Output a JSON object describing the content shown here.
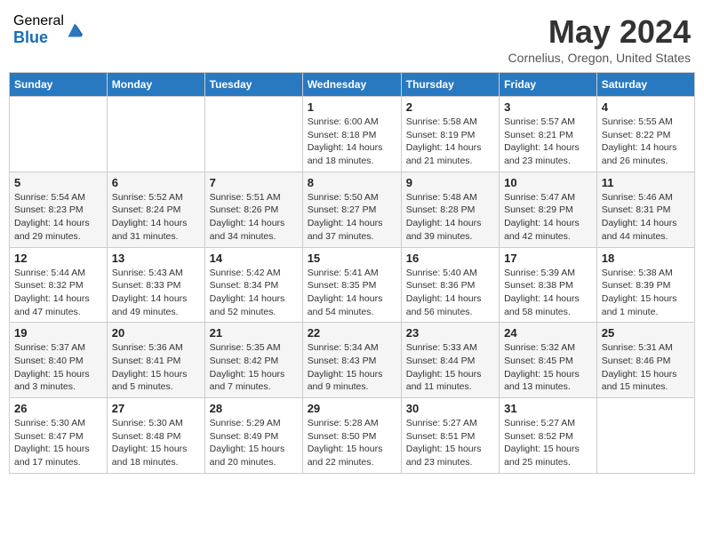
{
  "header": {
    "logo_general": "General",
    "logo_blue": "Blue",
    "month_title": "May 2024",
    "location": "Cornelius, Oregon, United States"
  },
  "days_of_week": [
    "Sunday",
    "Monday",
    "Tuesday",
    "Wednesday",
    "Thursday",
    "Friday",
    "Saturday"
  ],
  "weeks": [
    [
      {
        "day": "",
        "info": ""
      },
      {
        "day": "",
        "info": ""
      },
      {
        "day": "",
        "info": ""
      },
      {
        "day": "1",
        "info": "Sunrise: 6:00 AM\nSunset: 8:18 PM\nDaylight: 14 hours\nand 18 minutes."
      },
      {
        "day": "2",
        "info": "Sunrise: 5:58 AM\nSunset: 8:19 PM\nDaylight: 14 hours\nand 21 minutes."
      },
      {
        "day": "3",
        "info": "Sunrise: 5:57 AM\nSunset: 8:21 PM\nDaylight: 14 hours\nand 23 minutes."
      },
      {
        "day": "4",
        "info": "Sunrise: 5:55 AM\nSunset: 8:22 PM\nDaylight: 14 hours\nand 26 minutes."
      }
    ],
    [
      {
        "day": "5",
        "info": "Sunrise: 5:54 AM\nSunset: 8:23 PM\nDaylight: 14 hours\nand 29 minutes."
      },
      {
        "day": "6",
        "info": "Sunrise: 5:52 AM\nSunset: 8:24 PM\nDaylight: 14 hours\nand 31 minutes."
      },
      {
        "day": "7",
        "info": "Sunrise: 5:51 AM\nSunset: 8:26 PM\nDaylight: 14 hours\nand 34 minutes."
      },
      {
        "day": "8",
        "info": "Sunrise: 5:50 AM\nSunset: 8:27 PM\nDaylight: 14 hours\nand 37 minutes."
      },
      {
        "day": "9",
        "info": "Sunrise: 5:48 AM\nSunset: 8:28 PM\nDaylight: 14 hours\nand 39 minutes."
      },
      {
        "day": "10",
        "info": "Sunrise: 5:47 AM\nSunset: 8:29 PM\nDaylight: 14 hours\nand 42 minutes."
      },
      {
        "day": "11",
        "info": "Sunrise: 5:46 AM\nSunset: 8:31 PM\nDaylight: 14 hours\nand 44 minutes."
      }
    ],
    [
      {
        "day": "12",
        "info": "Sunrise: 5:44 AM\nSunset: 8:32 PM\nDaylight: 14 hours\nand 47 minutes."
      },
      {
        "day": "13",
        "info": "Sunrise: 5:43 AM\nSunset: 8:33 PM\nDaylight: 14 hours\nand 49 minutes."
      },
      {
        "day": "14",
        "info": "Sunrise: 5:42 AM\nSunset: 8:34 PM\nDaylight: 14 hours\nand 52 minutes."
      },
      {
        "day": "15",
        "info": "Sunrise: 5:41 AM\nSunset: 8:35 PM\nDaylight: 14 hours\nand 54 minutes."
      },
      {
        "day": "16",
        "info": "Sunrise: 5:40 AM\nSunset: 8:36 PM\nDaylight: 14 hours\nand 56 minutes."
      },
      {
        "day": "17",
        "info": "Sunrise: 5:39 AM\nSunset: 8:38 PM\nDaylight: 14 hours\nand 58 minutes."
      },
      {
        "day": "18",
        "info": "Sunrise: 5:38 AM\nSunset: 8:39 PM\nDaylight: 15 hours\nand 1 minute."
      }
    ],
    [
      {
        "day": "19",
        "info": "Sunrise: 5:37 AM\nSunset: 8:40 PM\nDaylight: 15 hours\nand 3 minutes."
      },
      {
        "day": "20",
        "info": "Sunrise: 5:36 AM\nSunset: 8:41 PM\nDaylight: 15 hours\nand 5 minutes."
      },
      {
        "day": "21",
        "info": "Sunrise: 5:35 AM\nSunset: 8:42 PM\nDaylight: 15 hours\nand 7 minutes."
      },
      {
        "day": "22",
        "info": "Sunrise: 5:34 AM\nSunset: 8:43 PM\nDaylight: 15 hours\nand 9 minutes."
      },
      {
        "day": "23",
        "info": "Sunrise: 5:33 AM\nSunset: 8:44 PM\nDaylight: 15 hours\nand 11 minutes."
      },
      {
        "day": "24",
        "info": "Sunrise: 5:32 AM\nSunset: 8:45 PM\nDaylight: 15 hours\nand 13 minutes."
      },
      {
        "day": "25",
        "info": "Sunrise: 5:31 AM\nSunset: 8:46 PM\nDaylight: 15 hours\nand 15 minutes."
      }
    ],
    [
      {
        "day": "26",
        "info": "Sunrise: 5:30 AM\nSunset: 8:47 PM\nDaylight: 15 hours\nand 17 minutes."
      },
      {
        "day": "27",
        "info": "Sunrise: 5:30 AM\nSunset: 8:48 PM\nDaylight: 15 hours\nand 18 minutes."
      },
      {
        "day": "28",
        "info": "Sunrise: 5:29 AM\nSunset: 8:49 PM\nDaylight: 15 hours\nand 20 minutes."
      },
      {
        "day": "29",
        "info": "Sunrise: 5:28 AM\nSunset: 8:50 PM\nDaylight: 15 hours\nand 22 minutes."
      },
      {
        "day": "30",
        "info": "Sunrise: 5:27 AM\nSunset: 8:51 PM\nDaylight: 15 hours\nand 23 minutes."
      },
      {
        "day": "31",
        "info": "Sunrise: 5:27 AM\nSunset: 8:52 PM\nDaylight: 15 hours\nand 25 minutes."
      },
      {
        "day": "",
        "info": ""
      }
    ]
  ]
}
